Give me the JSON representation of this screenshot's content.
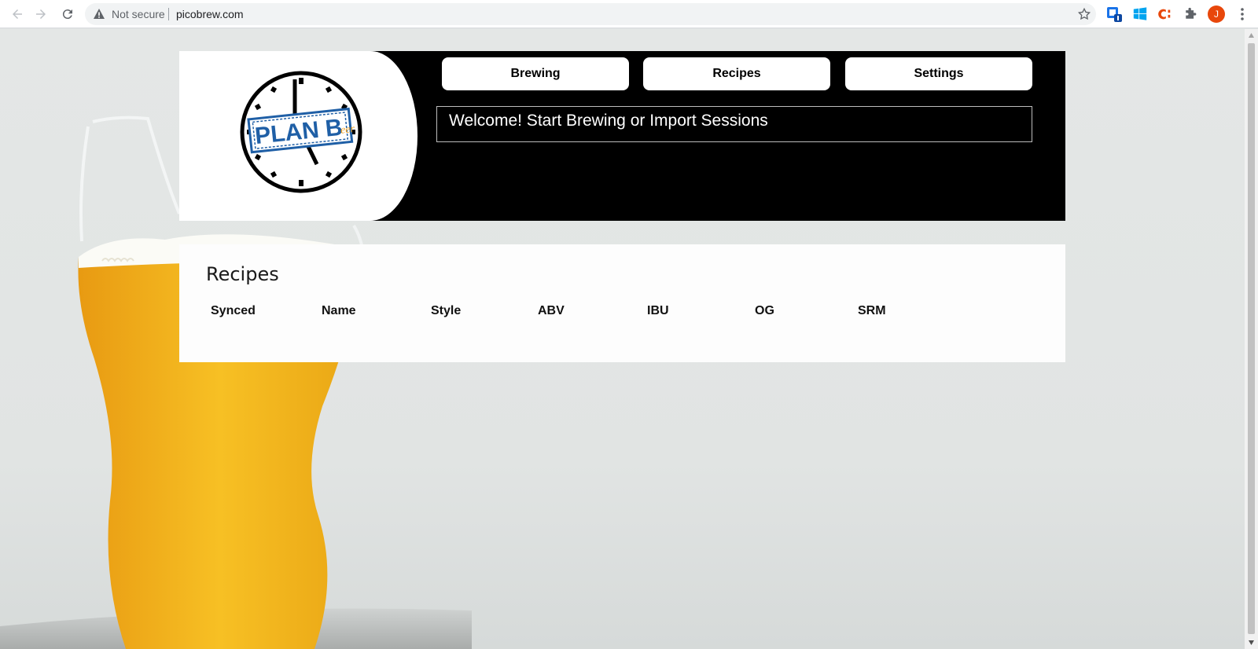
{
  "browser": {
    "security_label": "Not secure",
    "url": "picobrew.com",
    "profile_initial": "J",
    "extensions": [
      "extension-badge-icon",
      "windows-icon",
      "c-extension-icon",
      "puzzle-icon"
    ]
  },
  "app": {
    "logo_text": "PLAN B",
    "logo_suffix": "eer",
    "nav": {
      "tabs": [
        {
          "label": "Brewing"
        },
        {
          "label": "Recipes"
        },
        {
          "label": "Settings"
        }
      ]
    },
    "welcome_message": "Welcome! Start Brewing or Import Sessions"
  },
  "recipes": {
    "title": "Recipes",
    "columns": [
      "Synced",
      "Name",
      "Style",
      "ABV",
      "IBU",
      "OG",
      "SRM"
    ],
    "rows": []
  },
  "colors": {
    "header_bg": "#000000",
    "panel_bg": "#ffffff",
    "logo_blue": "#1f5fa6",
    "logo_orange": "#f0a020",
    "beer": "#f5b418"
  }
}
